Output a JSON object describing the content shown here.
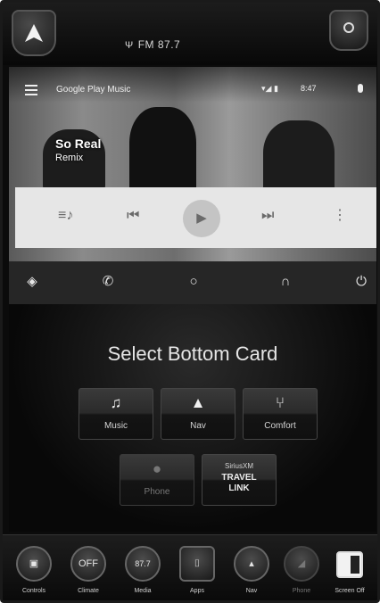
{
  "header": {
    "radio_station": "FM 87.7",
    "home_icon": "navigation-arrow-icon",
    "settings_icon": "settings-icon"
  },
  "android_auto": {
    "app_title": "Google Play Music",
    "time": "8:47",
    "now_playing": {
      "title": "So Real",
      "artist": "Remix"
    },
    "controls": [
      "queue-music-icon",
      "skip-previous-icon",
      "play-icon",
      "skip-next-icon",
      "more-vert-icon"
    ],
    "nav_icons": [
      "navigation-icon",
      "phone-icon",
      "home-circle-icon",
      "headphones-icon",
      "power-icon"
    ]
  },
  "select_card": {
    "title": "Select Bottom Card",
    "cards": [
      {
        "label": "Music",
        "icon": "music-note-icon"
      },
      {
        "label": "Nav",
        "icon": "nav-arrow-icon"
      },
      {
        "label": "Comfort",
        "icon": "seat-icon"
      },
      {
        "label": "Phone",
        "icon": "person-icon"
      },
      {
        "label_small": "SiriusXM",
        "label_big_1": "TRAVEL",
        "label_big_2": "LINK"
      }
    ]
  },
  "dock": {
    "items": [
      {
        "label": "Controls"
      },
      {
        "label": "Climate",
        "value": "OFF"
      },
      {
        "label": "Media",
        "value": "87.7"
      },
      {
        "label": "Apps"
      },
      {
        "label": "Nav"
      },
      {
        "label": "Phone"
      },
      {
        "label": "Screen Off"
      }
    ]
  },
  "colors": {
    "background": "#0b0b0b",
    "card_bg": "#e6e6e6",
    "text": "#e6e6e6"
  }
}
